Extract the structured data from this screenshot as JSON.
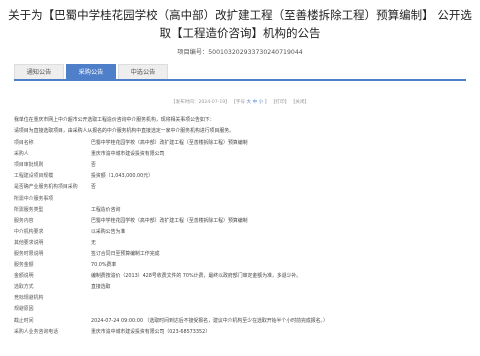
{
  "page": {
    "title": "关于为【巴蜀中学桂花园学校（高中部）改扩建工程（至善楼拆除工程）预算编制】 公开选取【工程造价咨询】机构的公告",
    "project_no": "项目编号：500103202933730240719044"
  },
  "tabs": [
    {
      "label": "通知公告"
    },
    {
      "label": "采购公告"
    },
    {
      "label": "中选公告"
    }
  ],
  "meta": {
    "date": "【发布时间：2024-07-19】",
    "font_label": "【字号",
    "font_big": "大",
    "font_mid": "中",
    "font_small": "小",
    "font_end": "】",
    "print": "【打印】",
    "close": "【关闭】"
  },
  "intro": {
    "line1": "我单位在重庆市网上中介超市公开选取工程造价咨询中介服务机构，现将相关事项公告如下：",
    "line2": "请项目为直接选取项目，由采购人从报名的中介服务机构中直接选定一家中介服务机构进行项目服务。"
  },
  "rows": [
    {
      "k": "项目名称",
      "v": "巴蜀中学桂花园学校（高中部）改扩建工程（至善楼拆除工程）预算编制"
    },
    {
      "k": "采购人",
      "v": "重庆市渝中城市建设投资有限公司"
    },
    {
      "k": "项目审批规则",
      "v": "否"
    },
    {
      "k": "工程建设项目规模",
      "v": "投资额（1,043,000.00元）"
    },
    {
      "k": "是否确产业服务机构项目采购",
      "v": "否"
    },
    {
      "k": "所需中介服务事项",
      "v": ""
    },
    {
      "k": "所需服务类型",
      "v": "工程造价咨询"
    },
    {
      "k": "服务内容",
      "v": "巴蜀中学桂花园学校（高中部）改扩建工程（至善楼拆除工程）预算编制"
    },
    {
      "k": "中介机构要求",
      "v": "以采购公告为准"
    },
    {
      "k": "其他要求说明",
      "v": "无"
    },
    {
      "k": "服务时限说明",
      "v": "签订合同日至预算编制工作完成"
    },
    {
      "k": "服务金额",
      "v": "70.0%费率"
    },
    {
      "k": "金额说明",
      "v": "编制费按渝价（2013）428号收费文件的 70%计费，最终以政府部门审定金额为准，多退少补。"
    },
    {
      "k": "选取方式",
      "v": "直接选取"
    },
    {
      "k": "竞标规避机构",
      "v": ""
    },
    {
      "k": "规避原因",
      "v": ""
    },
    {
      "k": "截止时间",
      "v": "2024-07-24 09:00:00 （选取时间到达后不接受报名，建议中介机构至少在选取开始半个小时前完成报名。）"
    },
    {
      "k": "采购人业务咨询电话",
      "v": "重庆市渝中城市建设投资有限公司（023-68573352）"
    }
  ]
}
